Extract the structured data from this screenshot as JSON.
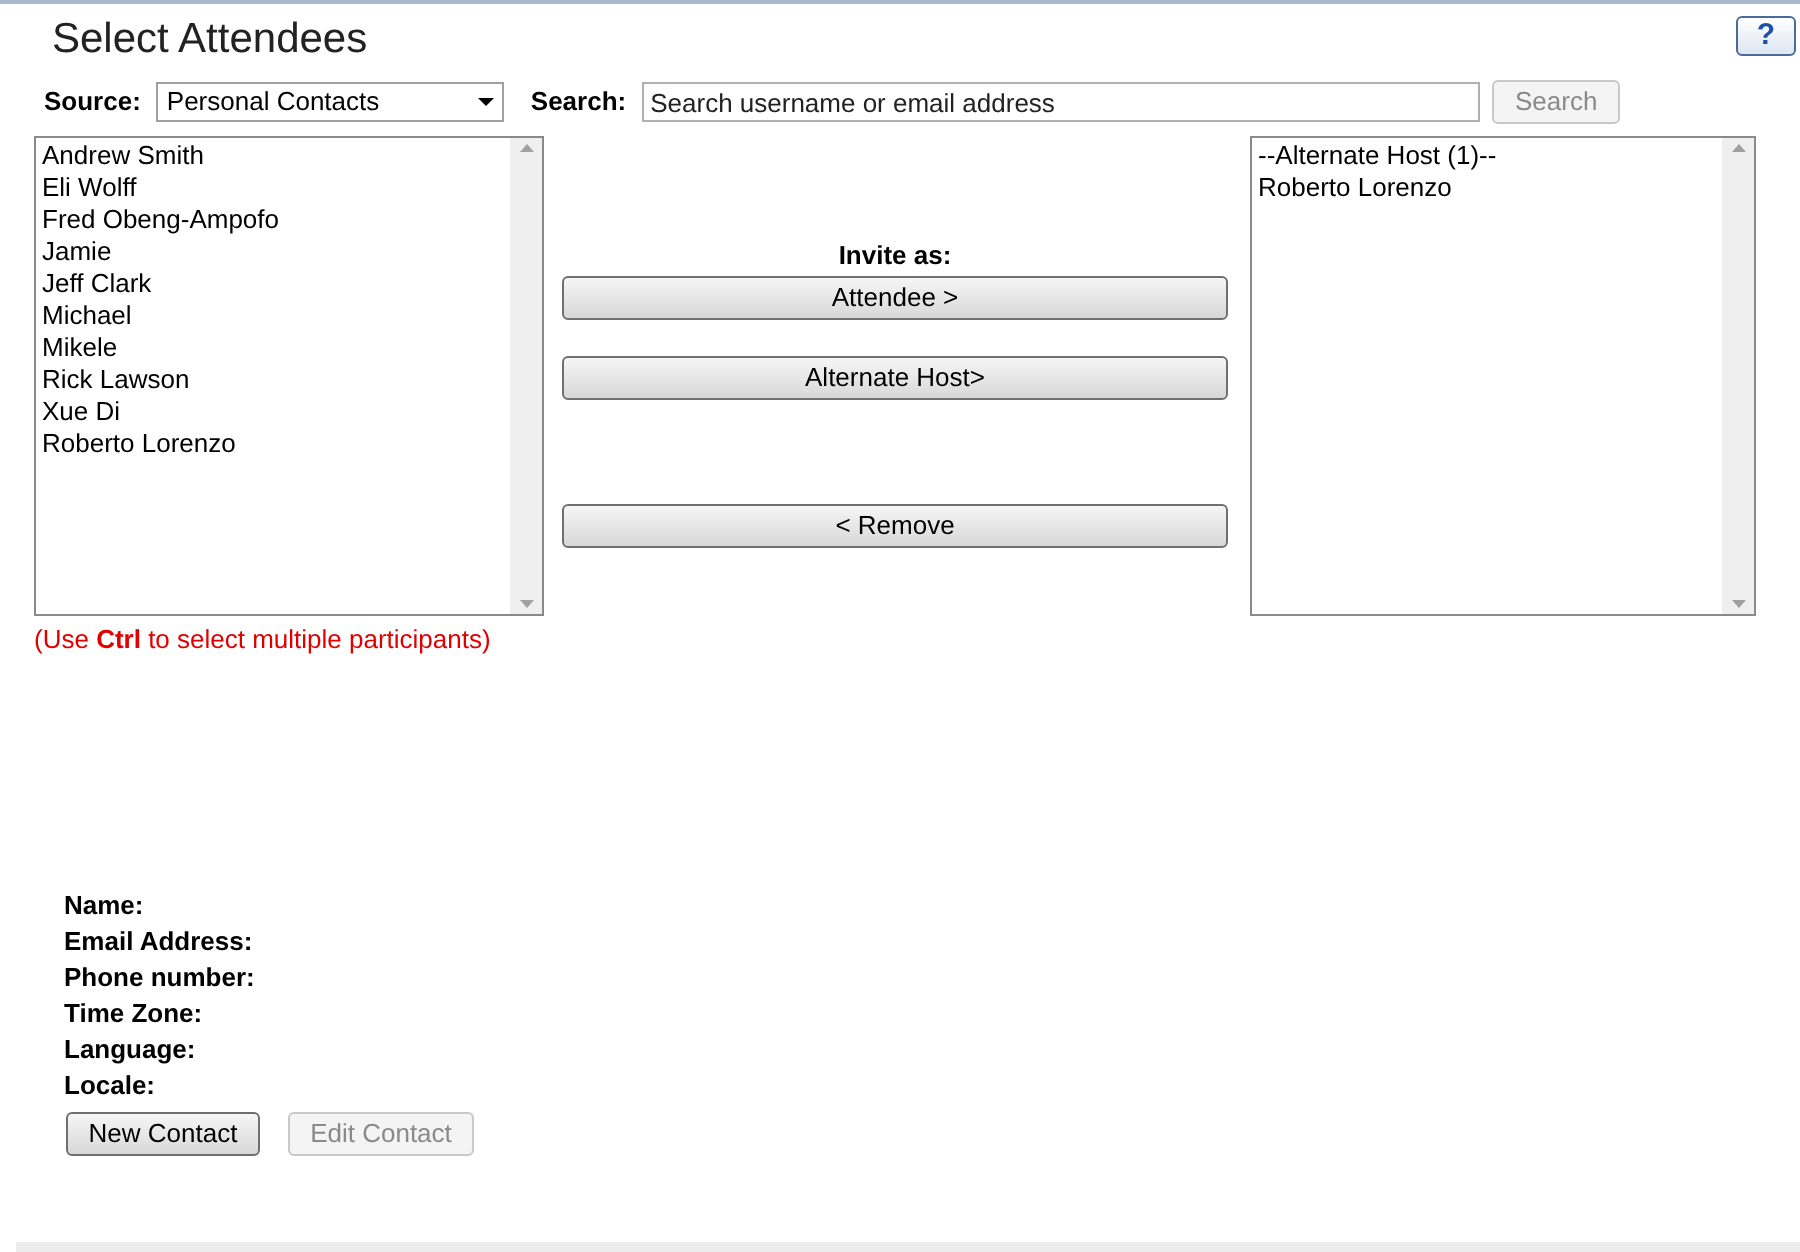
{
  "title": "Select Attendees",
  "help_button": {
    "label": "?"
  },
  "source": {
    "label": "Source:",
    "value": "Personal Contacts"
  },
  "search": {
    "label": "Search:",
    "placeholder": "Search username or email address",
    "button": {
      "label": "Search",
      "disabled": true
    }
  },
  "contacts": [
    "Andrew Smith",
    "Eli Wolff",
    "Fred Obeng-Ampofo",
    "Jamie",
    "Jeff Clark",
    "Michael",
    "Mikele",
    "Rick Lawson",
    "Xue Di",
    "Roberto Lorenzo"
  ],
  "hint": "(Use **Ctrl** to select multiple participants)",
  "invite_label": "Invite as:",
  "actions": [
    {
      "label": "Attendee >"
    },
    {
      "label": "Alternate Host>"
    },
    {
      "label": "< Remove"
    }
  ],
  "invitees": [
    "--Alternate Host (1)--",
    "Roberto Lorenzo"
  ],
  "details": [
    "Name:",
    "Email Address:",
    "Phone number:",
    "Time Zone:",
    "Language:",
    "Locale:"
  ],
  "buttons": [
    {
      "label": "New Contact",
      "disabled": false
    },
    {
      "label": "Edit Contact",
      "disabled": true
    }
  ]
}
